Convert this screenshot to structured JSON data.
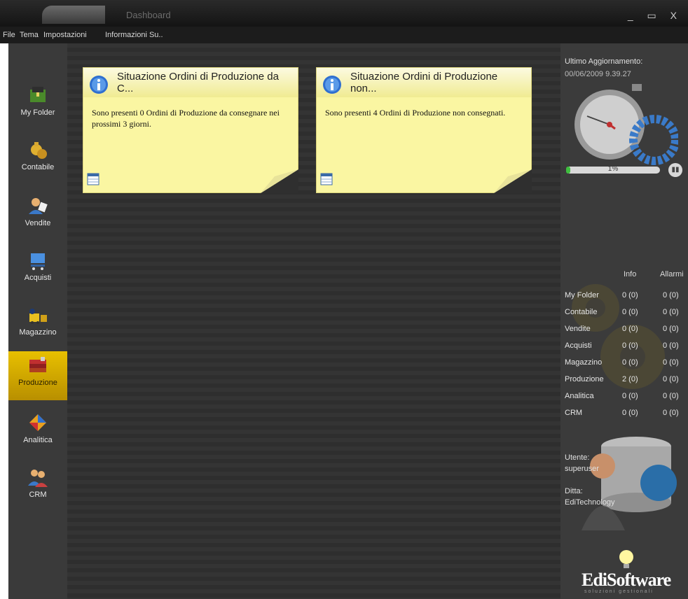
{
  "window": {
    "title": "Dashboard",
    "controls": "_ ▭ X"
  },
  "menu": [
    "File",
    "Tema",
    "Impostazioni",
    "Informazioni Su.."
  ],
  "sidebar": {
    "items": [
      {
        "label": "My Folder",
        "icon": "folder-icon"
      },
      {
        "label": "Contabile",
        "icon": "coins-icon"
      },
      {
        "label": "Vendite",
        "icon": "person-icon"
      },
      {
        "label": "Acquisti",
        "icon": "cart-icon"
      },
      {
        "label": "Magazzino",
        "icon": "forklift-icon"
      },
      {
        "label": "Produzione",
        "icon": "books-icon",
        "active": true
      },
      {
        "label": "Analitica",
        "icon": "chart-icon"
      },
      {
        "label": "CRM",
        "icon": "people-icon"
      }
    ]
  },
  "notes": [
    {
      "title": "Situazione Ordini di Produzione  da C...",
      "body": "Sono presenti 0 Ordini di Produzione da consegnare nei prossimi 3 giorni."
    },
    {
      "title": "Situazione Ordini di Produzione  non...",
      "body": "Sono presenti 4 Ordini di Produzione non consegnati."
    }
  ],
  "status": {
    "last_update_label": "Ultimo Aggiornamento:",
    "last_update_value": "00/06/2009 9.39.27",
    "progress_label": "1%",
    "progress_fraction": 0.01
  },
  "summary": {
    "headers": [
      "Info",
      "Allarmi"
    ],
    "rows": [
      {
        "name": "My Folder",
        "info": "0 (0)",
        "alarms": "0 (0)"
      },
      {
        "name": "Contabile",
        "info": "0 (0)",
        "alarms": "0 (0)"
      },
      {
        "name": "Vendite",
        "info": "0 (0)",
        "alarms": "0 (0)"
      },
      {
        "name": "Acquisti",
        "info": "0 (0)",
        "alarms": "0 (0)"
      },
      {
        "name": "Magazzino",
        "info": "0 (0)",
        "alarms": "0 (0)"
      },
      {
        "name": "Produzione",
        "info": "2 (0)",
        "alarms": "0 (0)"
      },
      {
        "name": "Analitica",
        "info": "0 (0)",
        "alarms": "0 (0)"
      },
      {
        "name": "CRM",
        "info": "0 (0)",
        "alarms": "0 (0)"
      }
    ]
  },
  "user": {
    "user_label": "Utente:",
    "user_value": "superuser",
    "company_label": "Ditta:",
    "company_value": "EdiTechnology"
  },
  "brand": {
    "name": "EdiSoftware",
    "tagline": "soluzioni gestionali"
  },
  "colors": {
    "note_bg": "#faf6a2",
    "active_nav": "#e8c000",
    "progress": "#3fbf3f"
  }
}
